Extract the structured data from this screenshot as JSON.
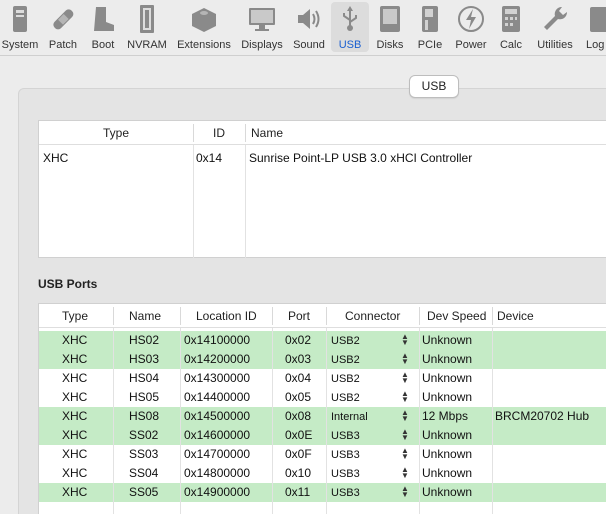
{
  "toolbar": {
    "items": [
      {
        "label": "System",
        "icon": "system-icon"
      },
      {
        "label": "Patch",
        "icon": "bandage-icon"
      },
      {
        "label": "Boot",
        "icon": "boot-icon"
      },
      {
        "label": "NVRAM",
        "icon": "nvram-icon"
      },
      {
        "label": "Extensions",
        "icon": "lego-brick-icon"
      },
      {
        "label": "Displays",
        "icon": "display-icon"
      },
      {
        "label": "Sound",
        "icon": "speaker-icon"
      },
      {
        "label": "USB",
        "icon": "usb-icon",
        "selected": true
      },
      {
        "label": "Disks",
        "icon": "disk-icon"
      },
      {
        "label": "PCIe",
        "icon": "pcie-card-icon"
      },
      {
        "label": "Power",
        "icon": "lightning-icon"
      },
      {
        "label": "Calc",
        "icon": "calculator-icon"
      },
      {
        "label": "Utilities",
        "icon": "wrench-icon"
      },
      {
        "label": "Log",
        "icon": "log-icon"
      }
    ]
  },
  "tab": {
    "label": "USB"
  },
  "controllers": {
    "headers": {
      "type": "Type",
      "id": "ID",
      "name": "Name"
    },
    "rows": [
      {
        "type": "XHC",
        "id": "0x14",
        "name": "Sunrise Point-LP USB 3.0 xHCI Controller"
      }
    ]
  },
  "ports_section": {
    "title": "USB Ports"
  },
  "ports": {
    "headers": {
      "type": "Type",
      "name": "Name",
      "location": "Location ID",
      "port": "Port",
      "connector": "Connector",
      "speed": "Dev Speed",
      "device": "Device"
    },
    "rows": [
      {
        "type": "XHC",
        "name": "HS02",
        "location": "0x14100000",
        "port": "0x02",
        "connector": "USB2",
        "speed": "Unknown",
        "device": "",
        "highlighted": true
      },
      {
        "type": "XHC",
        "name": "HS03",
        "location": "0x14200000",
        "port": "0x03",
        "connector": "USB2",
        "speed": "Unknown",
        "device": "",
        "highlighted": true
      },
      {
        "type": "XHC",
        "name": "HS04",
        "location": "0x14300000",
        "port": "0x04",
        "connector": "USB2",
        "speed": "Unknown",
        "device": "",
        "highlighted": false
      },
      {
        "type": "XHC",
        "name": "HS05",
        "location": "0x14400000",
        "port": "0x05",
        "connector": "USB2",
        "speed": "Unknown",
        "device": "",
        "highlighted": false
      },
      {
        "type": "XHC",
        "name": "HS08",
        "location": "0x14500000",
        "port": "0x08",
        "connector": "Internal",
        "speed": "12 Mbps",
        "device": "BRCM20702 Hub",
        "highlighted": true
      },
      {
        "type": "XHC",
        "name": "SS02",
        "location": "0x14600000",
        "port": "0x0E",
        "connector": "USB3",
        "speed": "Unknown",
        "device": "",
        "highlighted": true
      },
      {
        "type": "XHC",
        "name": "SS03",
        "location": "0x14700000",
        "port": "0x0F",
        "connector": "USB3",
        "speed": "Unknown",
        "device": "",
        "highlighted": false
      },
      {
        "type": "XHC",
        "name": "SS04",
        "location": "0x14800000",
        "port": "0x10",
        "connector": "USB3",
        "speed": "Unknown",
        "device": "",
        "highlighted": false
      },
      {
        "type": "XHC",
        "name": "SS05",
        "location": "0x14900000",
        "port": "0x11",
        "connector": "USB3",
        "speed": "Unknown",
        "device": "",
        "highlighted": true
      }
    ]
  },
  "colors": {
    "highlight": "#c5ebc6",
    "accent": "#1a5fd0"
  }
}
